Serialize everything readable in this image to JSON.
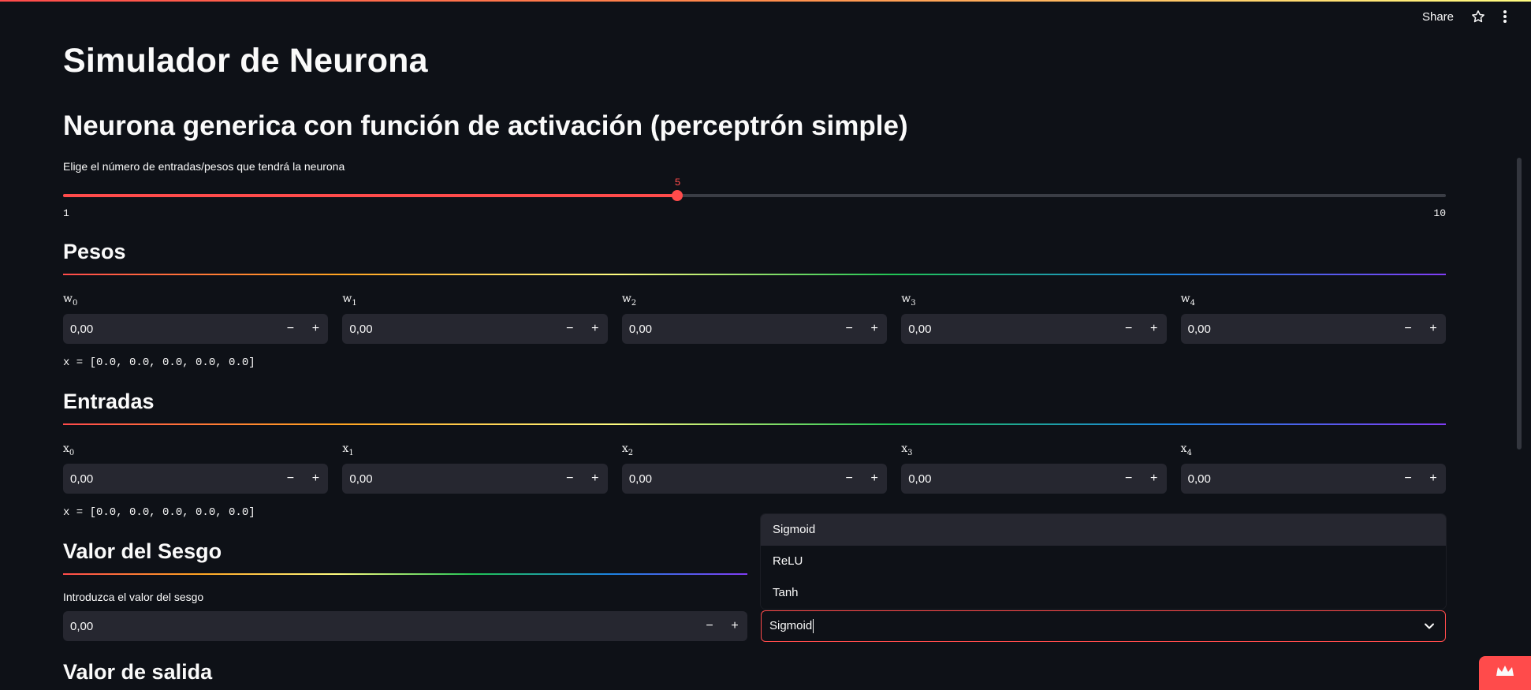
{
  "toolbar": {
    "share_label": "Share"
  },
  "page": {
    "title": "Simulador de Neurona",
    "subtitle": "Neurona generica con función de activación (perceptrón simple)"
  },
  "slider": {
    "label": "Elige el número de entradas/pesos que tendrá la neurona",
    "value": "5",
    "min": "1",
    "max": "10",
    "fraction": 0.4444
  },
  "weights": {
    "title": "Pesos",
    "fields": [
      {
        "symbol": "w",
        "index": "0",
        "value": "0,00"
      },
      {
        "symbol": "w",
        "index": "1",
        "value": "0,00"
      },
      {
        "symbol": "w",
        "index": "2",
        "value": "0,00"
      },
      {
        "symbol": "w",
        "index": "3",
        "value": "0,00"
      },
      {
        "symbol": "w",
        "index": "4",
        "value": "0,00"
      }
    ],
    "summary": "x = [0.0, 0.0, 0.0, 0.0, 0.0]"
  },
  "inputs": {
    "title": "Entradas",
    "fields": [
      {
        "symbol": "x",
        "index": "0",
        "value": "0,00"
      },
      {
        "symbol": "x",
        "index": "1",
        "value": "0,00"
      },
      {
        "symbol": "x",
        "index": "2",
        "value": "0,00"
      },
      {
        "symbol": "x",
        "index": "3",
        "value": "0,00"
      },
      {
        "symbol": "x",
        "index": "4",
        "value": "0,00"
      }
    ],
    "summary": "x = [0.0, 0.0, 0.0, 0.0, 0.0]"
  },
  "bias": {
    "title": "Valor del Sesgo",
    "label": "Introduzca el valor del sesgo",
    "value": "0,00"
  },
  "activation": {
    "options": [
      "Sigmoid",
      "ReLU",
      "Tanh"
    ],
    "selected": "Sigmoid"
  },
  "output": {
    "title": "Valor de salida"
  },
  "stepper": {
    "minus": "−",
    "plus": "+"
  },
  "colors": {
    "accent": "#ff4b4b",
    "background": "#0e1117",
    "input_bg": "#262730"
  }
}
